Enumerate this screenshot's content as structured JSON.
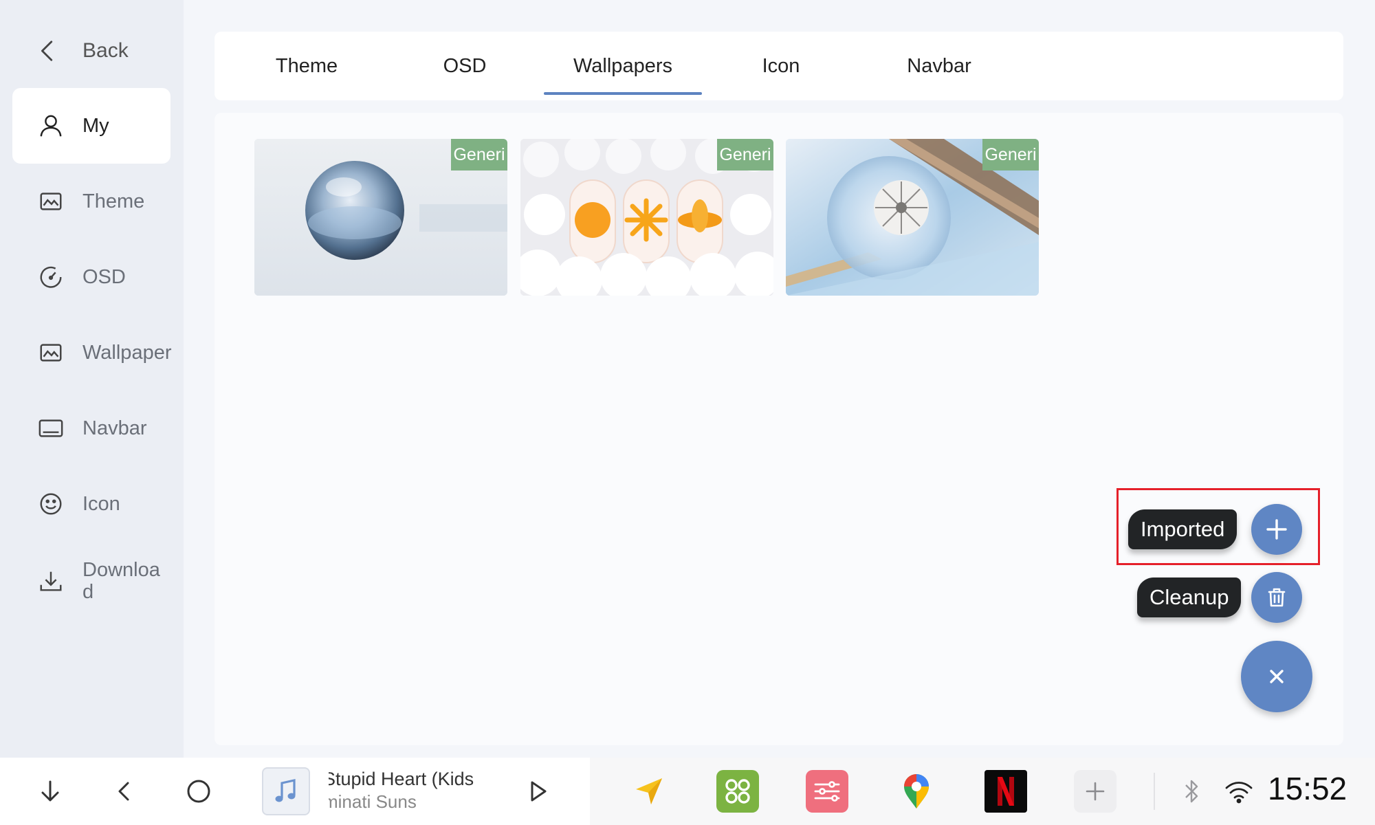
{
  "sidebar": {
    "back_label": "Back",
    "items": [
      {
        "label": "My",
        "icon": "user-icon"
      },
      {
        "label": "Theme",
        "icon": "image-icon"
      },
      {
        "label": "OSD",
        "icon": "gauge-icon"
      },
      {
        "label": "Wallpaper",
        "icon": "image-icon"
      },
      {
        "label": "Navbar",
        "icon": "navbar-icon"
      },
      {
        "label": "Icon",
        "icon": "smiley-icon"
      },
      {
        "label": "Downloa d",
        "icon": "download-icon"
      }
    ]
  },
  "tabs": [
    {
      "label": "Theme"
    },
    {
      "label": "OSD"
    },
    {
      "label": "Wallpapers"
    },
    {
      "label": "Icon"
    },
    {
      "label": "Navbar"
    }
  ],
  "active_tab": "Wallpapers",
  "wallpapers": [
    {
      "tag": "Generi"
    },
    {
      "tag": "Generi"
    },
    {
      "tag": "Generi"
    }
  ],
  "actions": {
    "imported_label": "Imported",
    "cleanup_label": "Cleanup"
  },
  "bottombar": {
    "song_title": "Stupid Heart (Kids",
    "song_artist": "minati Suns",
    "clock": "15:52"
  },
  "colors": {
    "accent": "#5f86c4",
    "tag_green": "#7fb183",
    "highlight_red": "#e5202a"
  }
}
